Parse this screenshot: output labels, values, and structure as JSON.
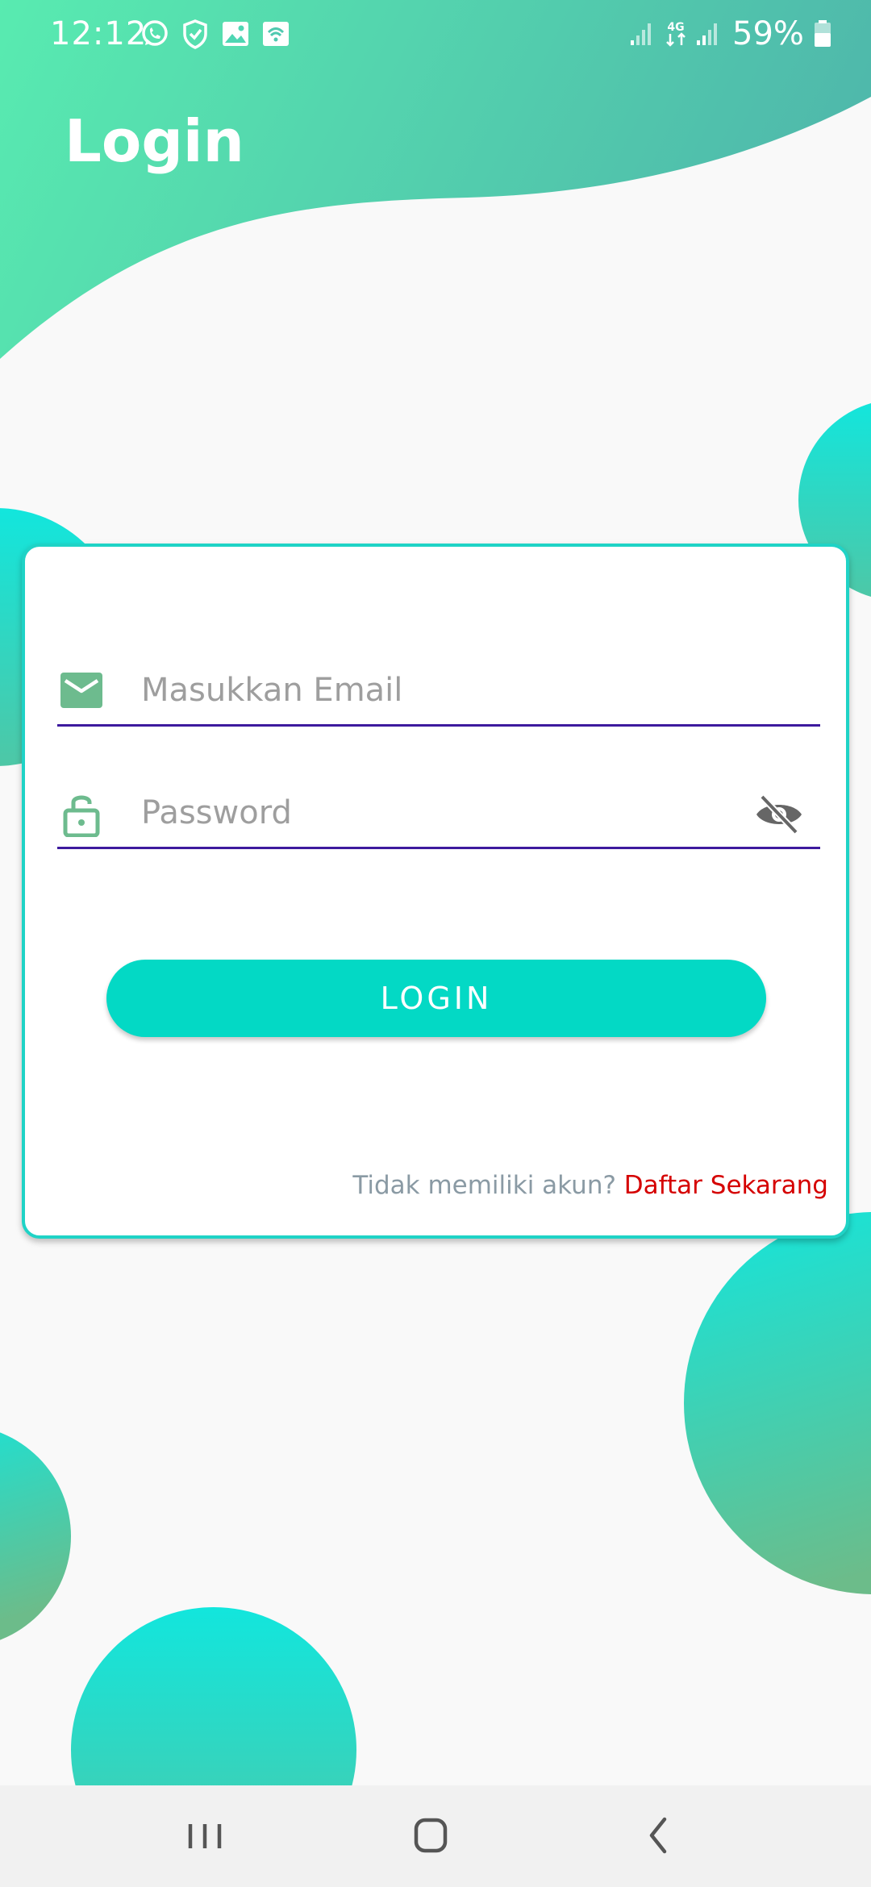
{
  "status_bar": {
    "time": "12:12",
    "battery_percent": "59%",
    "left_icons": [
      "whatsapp-icon",
      "shield-icon",
      "image-icon",
      "wifi-icon"
    ],
    "right_icons": [
      "signal-icon",
      "network-4g-icon",
      "signal-icon",
      "battery-icon"
    ]
  },
  "header": {
    "title": "Login"
  },
  "form": {
    "email": {
      "placeholder": "Masukkan Email",
      "value": "",
      "icon": "email-icon"
    },
    "password": {
      "placeholder": "Password",
      "value": "",
      "icon": "lock-icon",
      "toggle_icon": "eye-off-icon"
    },
    "login_label": "LOGIN",
    "register_prompt": "Tidak memiliki akun?",
    "register_link": "Daftar Sekarang"
  },
  "nav_bar": {
    "buttons": [
      "recent-apps-icon",
      "home-icon",
      "back-icon"
    ]
  },
  "colors": {
    "accent": "#03d9c5",
    "card_border": "#1fd3c6",
    "icon_green": "#6dbb8e",
    "underline": "#3d1a9e",
    "link_red": "#d50000",
    "header_gradient_start": "#58ebb0",
    "header_gradient_end": "#4fb9ab"
  }
}
